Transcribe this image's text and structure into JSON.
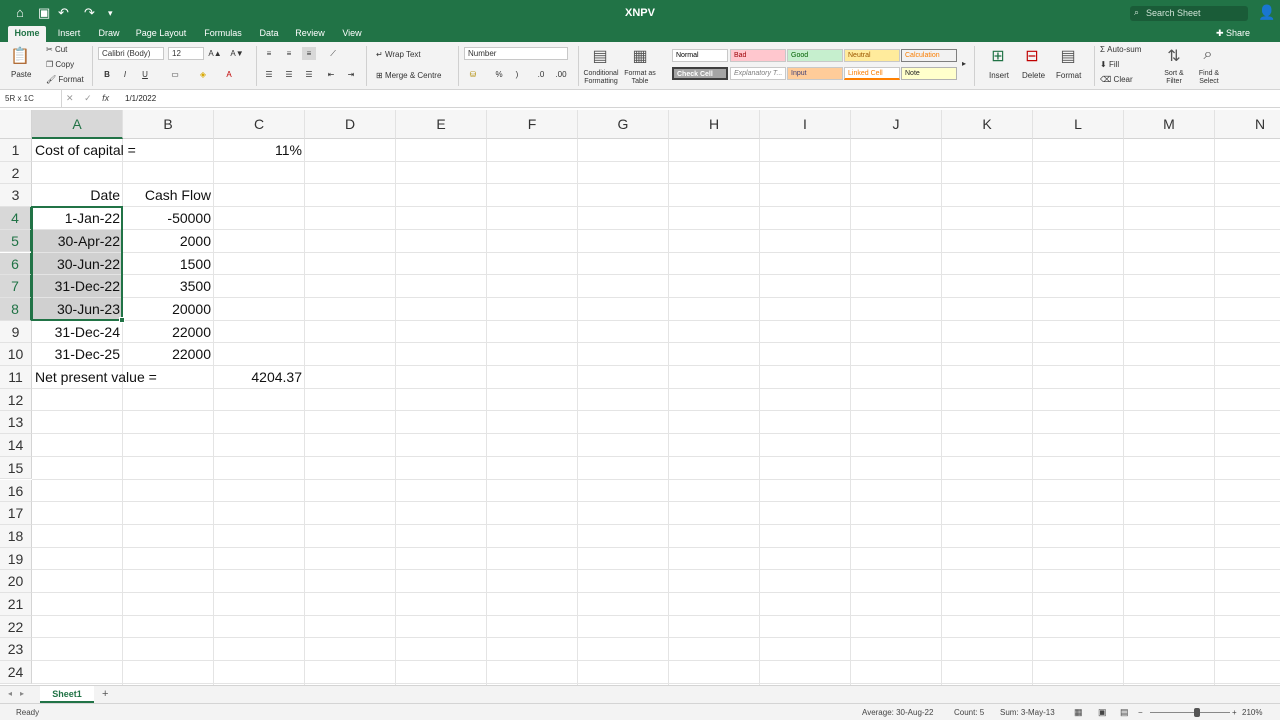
{
  "title_bar": {
    "title": "XNPV",
    "search_placeholder": "Search Sheet"
  },
  "tabs": [
    "Home",
    "Insert",
    "Draw",
    "Page Layout",
    "Formulas",
    "Data",
    "Review",
    "View"
  ],
  "share_label": "Share",
  "ribbon": {
    "paste": "Paste",
    "cut": "Cut",
    "copy": "Copy",
    "format_painter": "Format",
    "font_name": "Calibri (Body)",
    "font_size": "12",
    "bold": "B",
    "italic": "I",
    "underline": "U",
    "wrap_text": "Wrap Text",
    "merge_center": "Merge & Centre",
    "number_format": "Number",
    "percent": "%",
    "comma": ")",
    "conditional_formatting": "Conditional Formatting",
    "format_as_table": "Format as Table",
    "styles": [
      "Normal",
      "Bad",
      "Good",
      "Neutral",
      "Calculation",
      "Check Cell",
      "Explanatory T...",
      "Input",
      "Linked Cell",
      "Note"
    ],
    "insert": "Insert",
    "delete": "Delete",
    "format": "Format",
    "autosum": "Auto-sum",
    "fill": "Fill",
    "clear": "Clear",
    "sort_filter": "Sort & Filter",
    "find_select": "Find & Select"
  },
  "formula_bar": {
    "name_box": "5R x 1C",
    "fx": "fx",
    "value": "1/1/2022"
  },
  "columns": [
    "A",
    "B",
    "C",
    "D",
    "E",
    "F",
    "G",
    "H",
    "I",
    "J",
    "K",
    "L",
    "M",
    "N"
  ],
  "rows": [
    "1",
    "2",
    "3",
    "4",
    "5",
    "6",
    "7",
    "8",
    "9",
    "10",
    "11",
    "12",
    "13",
    "14",
    "15",
    "16",
    "17",
    "18",
    "19",
    "20",
    "21",
    "22",
    "23",
    "24"
  ],
  "cells": {
    "A1": "Cost of capital =",
    "C1": "11%",
    "A3": "Date",
    "B3": "Cash Flow",
    "A4": "1-Jan-22",
    "B4": "-50000",
    "A5": "30-Apr-22",
    "B5": "2000",
    "A6": "30-Jun-22",
    "B6": "1500",
    "A7": "31-Dec-22",
    "B7": "3500",
    "A8": "30-Jun-23",
    "B8": "20000",
    "A9": "31-Dec-24",
    "B9": "22000",
    "A10": "31-Dec-25",
    "B10": "22000",
    "A11": "Net present value =",
    "C11": "4204.37"
  },
  "sheet_tab": "Sheet1",
  "status": {
    "ready": "Ready",
    "average": "Average: 30-Aug-22",
    "count": "Count: 5",
    "sum": "Sum: 3-May-13",
    "zoom": "210%"
  }
}
